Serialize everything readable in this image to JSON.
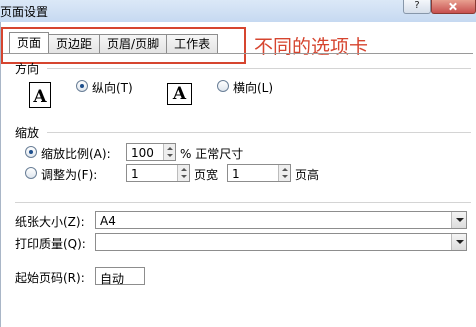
{
  "window": {
    "title": "页面设置"
  },
  "tabs": [
    {
      "label": "页面",
      "active": true
    },
    {
      "label": "页边距",
      "active": false
    },
    {
      "label": "页眉/页脚",
      "active": false
    },
    {
      "label": "工作表",
      "active": false
    }
  ],
  "annotation": {
    "text": "不同的选项卡",
    "color": "#d6452f"
  },
  "orientation": {
    "group_label": "方向",
    "portrait_icon_glyph": "A",
    "landscape_icon_glyph": "A",
    "portrait_label": "纵向(T)",
    "landscape_label": "横向(L)",
    "selected": "portrait"
  },
  "scaling": {
    "group_label": "缩放",
    "adjust_to_label": "缩放比例(A):",
    "adjust_value": "100",
    "percent_suffix": "% 正常尺寸",
    "fit_to_label": "调整为(F):",
    "pages_wide_value": "1",
    "pages_wide_label": "页宽",
    "pages_tall_value": "1",
    "pages_tall_label": "页高",
    "selected": "adjust_to"
  },
  "paper": {
    "paper_size_label": "纸张大小(Z):",
    "paper_size_value": "A4",
    "print_quality_label": "打印质量(Q):",
    "print_quality_value": "",
    "first_page_label": "起始页码(R):",
    "first_page_value": "自动"
  },
  "icons": {
    "help": "help-icon",
    "close": "close-icon"
  },
  "colors": {
    "accent": "#d6452f",
    "title_bar": "#c6d9f1"
  }
}
